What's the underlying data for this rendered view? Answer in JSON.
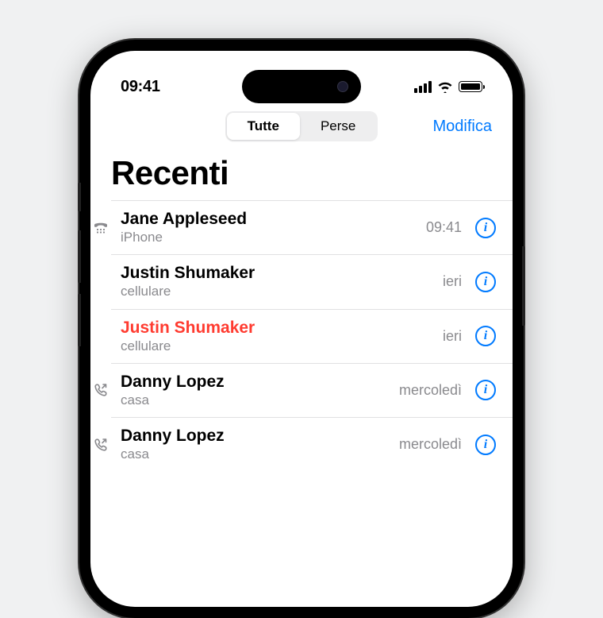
{
  "status": {
    "time": "09:41"
  },
  "nav": {
    "segments": {
      "all": "Tutte",
      "missed": "Perse"
    },
    "edit": "Modifica"
  },
  "title": "Recenti",
  "info_glyph": "i",
  "calls": [
    {
      "name": "Jane Appleseed",
      "sub": "iPhone",
      "time": "09:41",
      "missed": false,
      "icon": "tty"
    },
    {
      "name": "Justin Shumaker",
      "sub": "cellulare",
      "time": "ieri",
      "missed": false,
      "icon": ""
    },
    {
      "name": "Justin Shumaker",
      "sub": "cellulare",
      "time": "ieri",
      "missed": true,
      "icon": ""
    },
    {
      "name": "Danny Lopez",
      "sub": "casa",
      "time": "mercoledì",
      "missed": false,
      "icon": "outgoing"
    },
    {
      "name": "Danny Lopez",
      "sub": "casa",
      "time": "mercoledì",
      "missed": false,
      "icon": "outgoing"
    }
  ]
}
